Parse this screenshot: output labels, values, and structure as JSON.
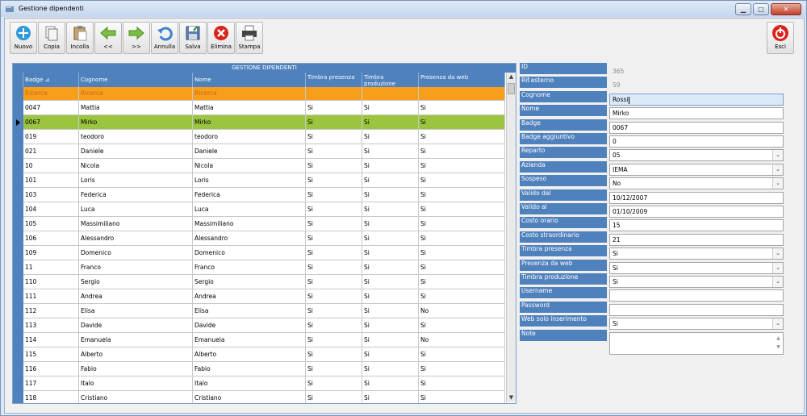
{
  "window": {
    "title": "Gestione dipendenti",
    "controls": [
      "minimize",
      "maximize",
      "close"
    ]
  },
  "toolbar": {
    "buttons": [
      {
        "id": "new",
        "label": "Nuovo",
        "icon": "plus-circle-icon"
      },
      {
        "id": "copy",
        "label": "Copia",
        "icon": "copy-icon"
      },
      {
        "id": "paste",
        "label": "Incolla",
        "icon": "paste-icon"
      },
      {
        "id": "prev",
        "label": "<<",
        "icon": "arrow-left-icon"
      },
      {
        "id": "next",
        "label": ">>",
        "icon": "arrow-right-icon"
      },
      {
        "id": "undo",
        "label": "Annulla",
        "icon": "undo-icon"
      },
      {
        "id": "save",
        "label": "Salva",
        "icon": "save-icon"
      },
      {
        "id": "delete",
        "label": "Elimina",
        "icon": "delete-icon"
      },
      {
        "id": "print",
        "label": "Stampa",
        "icon": "printer-icon"
      }
    ],
    "exit_label": "Esci"
  },
  "grid": {
    "caption": "GESTIONE DIPENDENTI",
    "columns": [
      "Badge ⊿",
      "Cognome",
      "Nome",
      "Timbra presenza",
      "Timbra produzione",
      "Presenza da web"
    ],
    "filter_text": [
      "Ricerca",
      "Ricerca",
      "Ricerca",
      "",
      "",
      ""
    ],
    "selected_index": 1,
    "rows": [
      [
        "0047",
        "Mattia",
        "Mattia",
        "Si",
        "Si",
        "Si"
      ],
      [
        "0067",
        "Mirko",
        "Mirko",
        "Si",
        "Si",
        "Si"
      ],
      [
        "019",
        "teodoro",
        "teodoro",
        "Si",
        "Si",
        "Si"
      ],
      [
        "021",
        "Daniele",
        "Daniele",
        "Si",
        "Si",
        "Si"
      ],
      [
        "10",
        "Nicola",
        "Nicola",
        "Si",
        "Si",
        "Si"
      ],
      [
        "101",
        "Loris",
        "Loris",
        "Si",
        "Si",
        "Si"
      ],
      [
        "103",
        "Federica",
        "Federica",
        "Si",
        "Si",
        "Si"
      ],
      [
        "104",
        "Luca",
        "Luca",
        "Si",
        "Si",
        "Si"
      ],
      [
        "105",
        "Massimiliano",
        "Massimiliano",
        "Si",
        "Si",
        "Si"
      ],
      [
        "106",
        "Alessandro",
        "Alessandro",
        "Si",
        "Si",
        "Si"
      ],
      [
        "109",
        "Domenico",
        "Domenico",
        "Si",
        "Si",
        "Si"
      ],
      [
        "11",
        "Franco",
        "Franco",
        "Si",
        "Si",
        "Si"
      ],
      [
        "110",
        "Sergio",
        "Sergio",
        "Si",
        "Si",
        "Si"
      ],
      [
        "111",
        "Andrea",
        "Andrea",
        "Si",
        "Si",
        "Si"
      ],
      [
        "112",
        "Elisa",
        "Elisa",
        "Si",
        "Si",
        "No"
      ],
      [
        "113",
        "Davide",
        "Davide",
        "Si",
        "Si",
        "Si"
      ],
      [
        "114",
        "Emanuela",
        "Emanuela",
        "Si",
        "Si",
        "No"
      ],
      [
        "115",
        "Alberto",
        "Alberto",
        "Si",
        "Si",
        "Si"
      ],
      [
        "116",
        "Fabio",
        "Fabio",
        "Si",
        "Si",
        "Si"
      ],
      [
        "117",
        "Italo",
        "Italo",
        "Si",
        "Si",
        "Si"
      ],
      [
        "118",
        "Cristiano",
        "Cristiano",
        "Si",
        "Si",
        "Si"
      ]
    ]
  },
  "form": {
    "fields": [
      {
        "label": "ID",
        "value": "365",
        "kind": "readonly"
      },
      {
        "label": "Rif.esterno",
        "value": "59",
        "kind": "readonly"
      },
      {
        "label": "Cognome",
        "value": "Rossi",
        "kind": "focused"
      },
      {
        "label": "Nome",
        "value": "Mirko",
        "kind": "text"
      },
      {
        "label": "Badge",
        "value": "0067",
        "kind": "text"
      },
      {
        "label": "Badge aggiuntivo",
        "value": "0",
        "kind": "text"
      },
      {
        "label": "Reparto",
        "value": "05",
        "kind": "select"
      },
      {
        "label": "Azienda",
        "value": "IEMA",
        "kind": "select"
      },
      {
        "label": "Sospeso",
        "value": "No",
        "kind": "select"
      },
      {
        "label": "Valido dal",
        "value": "10/12/2007",
        "kind": "text"
      },
      {
        "label": "Valido al",
        "value": "01/10/2009",
        "kind": "text"
      },
      {
        "label": "Costo orario",
        "value": "15",
        "kind": "text"
      },
      {
        "label": "Costo straordinario",
        "value": "21",
        "kind": "text"
      },
      {
        "label": "Timbra presenza",
        "value": "Si",
        "kind": "select"
      },
      {
        "label": "Presenza da web",
        "value": "Si",
        "kind": "select"
      },
      {
        "label": "Timbra produzione",
        "value": "Si",
        "kind": "select"
      },
      {
        "label": "Username",
        "value": "",
        "kind": "text"
      },
      {
        "label": "Password",
        "value": "",
        "kind": "text"
      },
      {
        "label": "Web solo inserimento",
        "value": "Si",
        "kind": "select"
      },
      {
        "label": "Note",
        "value": "",
        "kind": "textarea"
      }
    ]
  },
  "colors": {
    "header_blue": "#4f81bd",
    "selected_row": "#9bc43f",
    "filter_row": "#f79e1b"
  }
}
